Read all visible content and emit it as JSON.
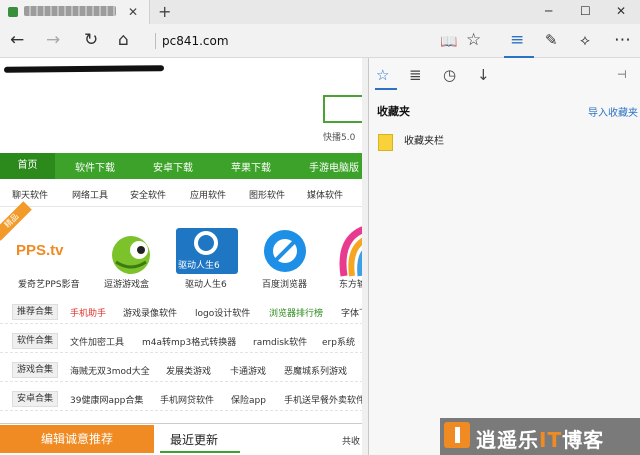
{
  "window": {
    "minimize_icon": "minimize-icon",
    "maximize_icon": "maximize-icon",
    "close_icon": "close-icon",
    "new_tab_label": "+",
    "tab_close_label": "✕"
  },
  "address_bar": {
    "url": "pc841.com",
    "icons": [
      "back-arrow-icon",
      "forward-arrow-icon",
      "refresh-icon",
      "home-icon",
      "reading-view-icon",
      "favorite-star-icon",
      "hub-icon",
      "web-note-icon",
      "share-icon",
      "more-icon"
    ]
  },
  "page": {
    "search_caption": "快播5.0",
    "main_nav": [
      "首页",
      "软件下载",
      "安卓下载",
      "苹果下载",
      "手游电脑版"
    ],
    "sub_nav": [
      "聊天软件",
      "网络工具",
      "安全软件",
      "应用软件",
      "图形软件",
      "媒体软件"
    ],
    "corner_badge": "精品",
    "apps": [
      {
        "name": "爱奇艺PPS影音",
        "logo": "PPS.tv"
      },
      {
        "name": "逗游游戏盒",
        "logo": ""
      },
      {
        "name": "驱动人生6",
        "logo": "驱动人生6"
      },
      {
        "name": "百度浏览器",
        "logo": ""
      },
      {
        "name": "东方输",
        "logo": ""
      }
    ],
    "rows": [
      {
        "tag": "推荐合集",
        "items": [
          "手机助手",
          "游戏录像软件",
          "logo设计软件",
          "浏览器排行榜",
          "字体下"
        ]
      },
      {
        "tag": "软件合集",
        "items": [
          "文件加密工具",
          "m4a转mp3格式转换器",
          "ramdisk软件",
          "erp系统"
        ]
      },
      {
        "tag": "游戏合集",
        "items": [
          "海贼无双3mod大全",
          "发展类游戏",
          "卡通游戏",
          "恶魔城系列游戏"
        ]
      },
      {
        "tag": "安卓合集",
        "items": [
          "39健康网app合集",
          "手机网贷软件",
          "保险app",
          "手机送早餐外卖软件"
        ]
      }
    ],
    "bottom": {
      "editor_pick": "编辑诚意推荐",
      "latest": "最近更新",
      "shared": "共收"
    }
  },
  "hub": {
    "tabs": [
      "favorites-icon",
      "reading-list-icon",
      "history-icon",
      "downloads-icon"
    ],
    "title": "收藏夹",
    "import_link": "导入收藏夹",
    "folder": "收藏夹栏",
    "pin_icon": "pin-icon"
  },
  "watermark": {
    "prefix": "逍遥乐",
    "highlight": "IT",
    "suffix": "博客"
  },
  "colors": {
    "accent_blue": "#2b72c4",
    "site_green": "#3ca229",
    "site_orange": "#f08a22",
    "link_red": "#e0322a"
  }
}
